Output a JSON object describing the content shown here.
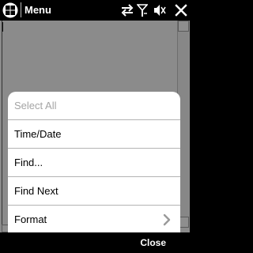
{
  "titlebar": {
    "title": "Menu"
  },
  "menu": {
    "items": [
      {
        "label": "Select All",
        "enabled": false,
        "has_submenu": false
      },
      {
        "label": "Time/Date",
        "enabled": true,
        "has_submenu": false
      },
      {
        "label": "Find...",
        "enabled": true,
        "has_submenu": false
      },
      {
        "label": "Find Next",
        "enabled": true,
        "has_submenu": false
      },
      {
        "label": "Format",
        "enabled": true,
        "has_submenu": true
      }
    ]
  },
  "softkeys": {
    "right_label": "Close"
  },
  "colors": {
    "bar_background": "#000000",
    "bar_text": "#ffffff",
    "dimmed_background": "#8b8b8b",
    "menu_background": "#ffffff",
    "disabled_text": "#a4a4a4",
    "separator": "#b3b3b3"
  },
  "icons": {
    "start": "windows-flag-icon",
    "sync": "sync-arrows-icon",
    "signal": "signal-antenna-icon",
    "volume": "speaker-muted-icon",
    "close": "close-x-icon",
    "submenu": "chevron-right-icon"
  }
}
